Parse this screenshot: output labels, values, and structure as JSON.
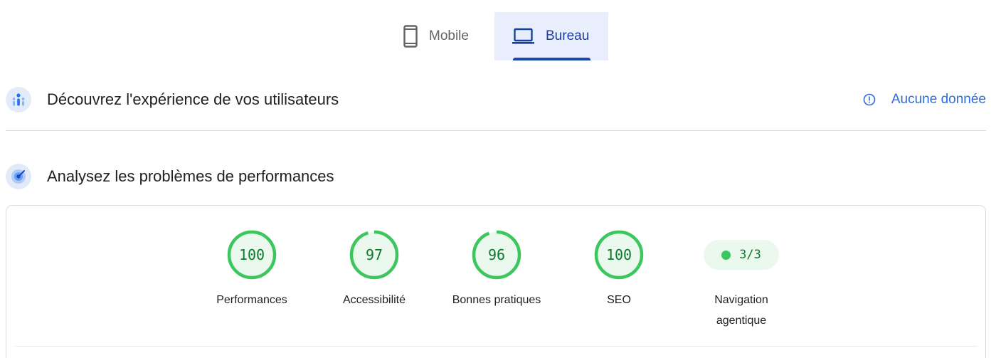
{
  "tabs": {
    "mobile": {
      "label": "Mobile",
      "icon": "smartphone-icon"
    },
    "desktop": {
      "label": "Bureau",
      "icon": "laptop-icon",
      "selected": true
    }
  },
  "crux": {
    "title": "Découvrez l'expérience de vos utilisateurs",
    "icon": "crux-icon",
    "status": {
      "label": "Aucune donnée",
      "icon": "info-icon"
    }
  },
  "lighthouse": {
    "title": "Analysez les problèmes de performances",
    "icon": "lighthouse-icon",
    "scores": [
      {
        "label": "Performances",
        "score": "100",
        "value": 100
      },
      {
        "label": "Accessibilité",
        "score": "97",
        "value": 97
      },
      {
        "label": "Bonnes pratiques",
        "score": "96",
        "value": 96
      },
      {
        "label": "SEO",
        "score": "100",
        "value": 100
      }
    ],
    "agentic": {
      "label": "Navigation agentique",
      "label_line1": "Navigation",
      "label_line2": "agentique",
      "score": "3/3",
      "passed": 3,
      "total": 3
    }
  },
  "colors": {
    "pass_green": "#3cc65d",
    "pass_green_fill": "#ebf8ee",
    "pass_text": "#0b7a2c",
    "accent_blue": "#2f6ad9",
    "tab_selected_bg": "#e8eefc"
  }
}
